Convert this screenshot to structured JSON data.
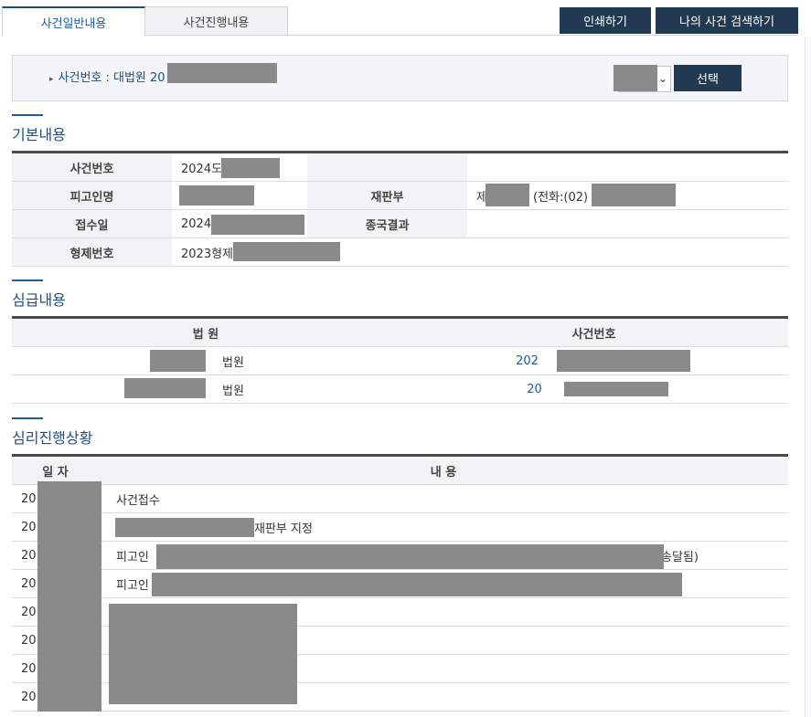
{
  "tabs": [
    {
      "label": "사건일반내용",
      "active": true
    },
    {
      "label": "사건진행내용",
      "active": false
    }
  ],
  "toolbar": {
    "print_label": "인쇄하기",
    "search_label": "나의 사건 검색하기"
  },
  "case_selector": {
    "label": "사건번호 : 대법원 20",
    "select_value": "",
    "choose_label": "선택"
  },
  "basic": {
    "title": "기본내용",
    "rows": [
      {
        "h1": "사건번호",
        "v1": "2024도",
        "h2": "",
        "v2": ""
      },
      {
        "h1": "피고인명",
        "v1": "",
        "h2": "재판부",
        "v2": "제",
        "v2b": "(전화:(02)"
      },
      {
        "h1": "접수일",
        "v1": "2024.",
        "h2": "종국결과",
        "v2": ""
      },
      {
        "h1": "형제번호",
        "v1": "2023형제",
        "h2": "",
        "v2": ""
      }
    ]
  },
  "lower_court": {
    "title": "심급내용",
    "headers": {
      "court": "법 원",
      "case_no": "사건번호"
    },
    "rows": [
      {
        "court": "법원",
        "case_no": "202"
      },
      {
        "court": "법원",
        "case_no": "20"
      }
    ]
  },
  "progress": {
    "title": "심리진행상황",
    "headers": {
      "date": "일 자",
      "content": "내 용"
    },
    "rows": [
      {
        "date": "20",
        "content": "사건접수"
      },
      {
        "date": "20",
        "content": "재판부 지정"
      },
      {
        "date": "20",
        "content": "피고인",
        "content_tail": "송달됨)"
      },
      {
        "date": "20",
        "content": "피고인"
      },
      {
        "date": "20",
        "content": ""
      },
      {
        "date": "20",
        "content": ""
      },
      {
        "date": "20",
        "content": ""
      },
      {
        "date": "20",
        "content": ""
      }
    ]
  },
  "colors": {
    "accent": "#1f5c99",
    "dark_button": "#213a52",
    "redaction": "#8a8a8a"
  }
}
